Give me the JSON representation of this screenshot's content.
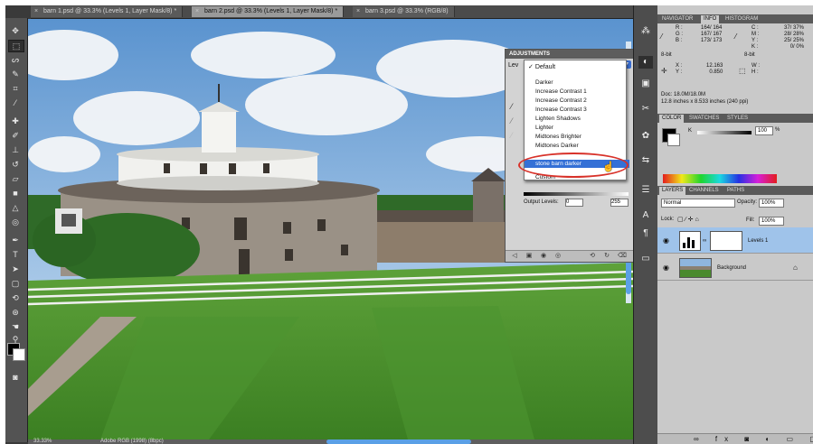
{
  "tabs": [
    {
      "label": "barn 1.psd @ 33.3% (Levels 1, Layer Mask/8) *",
      "close": "×"
    },
    {
      "label": "barn 2.psd @ 33.3% (Levels 1, Layer Mask/8) *",
      "close": "×"
    },
    {
      "label": "barn 3.psd @ 33.3% (RGB/8)",
      "close": "×"
    }
  ],
  "toolbar": {
    "icons": [
      "move-icon",
      "marquee-icon",
      "lasso-icon",
      "quick-select-icon",
      "crop-icon",
      "eyedropper-icon",
      "healing-icon",
      "brush-icon",
      "stamp-icon",
      "history-brush-icon",
      "eraser-icon",
      "gradient-icon",
      "blur-icon",
      "dodge-icon",
      "pen-icon",
      "type-icon",
      "path-select-icon",
      "shape-icon",
      "3d-rotate-icon",
      "3d-orbit-icon",
      "hand-icon",
      "zoom-icon"
    ]
  },
  "statusbar": {
    "zoom": "33.33%",
    "doc": "Adobe RGB (1998) (8bpc)"
  },
  "adjustments": {
    "title": "ADJUSTMENTS",
    "label": "Lev",
    "output_levels_label": "Output Levels:",
    "output_min": "0",
    "output_max": "255"
  },
  "preset_menu": {
    "checked": "✓",
    "items": [
      "Default",
      "Darker",
      "Increase Contrast 1",
      "Increase Contrast 2",
      "Increase Contrast 3",
      "Lighten Shadows",
      "Lighter",
      "Midtones Brighter",
      "Midtones Darker",
      "stone barn darker",
      "Custom"
    ],
    "selected": "Default",
    "highlighted": "stone barn darker"
  },
  "info_panel": {
    "tabs": [
      "NAVIGATOR",
      "INFO",
      "HISTOGRAM"
    ],
    "active": "INFO",
    "rgb_labels": [
      "R :",
      "G :",
      "B :"
    ],
    "rgb_values": [
      "164/ 164",
      "167/ 167",
      "173/ 173"
    ],
    "cmyk_labels": [
      "C :",
      "M :",
      "Y :",
      "K :"
    ],
    "cmyk_values": [
      "37/ 37%",
      "28/ 28%",
      "25/ 25%",
      "0/ 0%"
    ],
    "bit_left": "8-bit",
    "bit_right": "8-bit",
    "x_label": "X :",
    "y_label": "Y :",
    "x_value": "12.163",
    "y_value": "0.850",
    "w_label": "W :",
    "h_label": "H :",
    "doc_size": "Doc: 18.0M/18.0M",
    "dimensions": "12.8 inches x 8.533 inches (240 ppi)"
  },
  "color_panel": {
    "tabs": [
      "COLOR",
      "SWATCHES",
      "STYLES"
    ],
    "active": "COLOR",
    "channel": "K",
    "value": "100",
    "unit": "%"
  },
  "layers_panel": {
    "tabs": [
      "LAYERS",
      "CHANNELS",
      "PATHS"
    ],
    "active": "LAYERS",
    "blend_mode": "Normal",
    "opacity_label": "Opacity:",
    "opacity": "100%",
    "lock_label": "Lock:",
    "fill_label": "Fill:",
    "fill": "100%",
    "layers": [
      {
        "name": "Levels 1",
        "selected": true
      },
      {
        "name": "Background",
        "selected": false
      }
    ]
  },
  "colors": {
    "accent": "#3470d6",
    "highlight_oval": "#d8322a",
    "selected_layer": "#9fc3ea"
  }
}
